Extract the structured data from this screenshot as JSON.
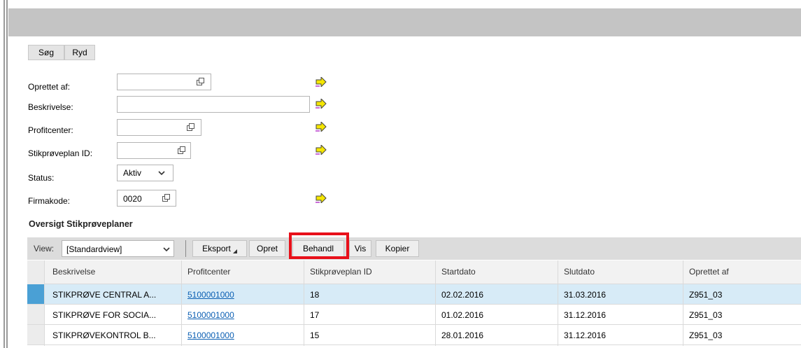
{
  "search": {
    "search_label": "Søg",
    "clear_label": "Ryd"
  },
  "form": {
    "created_by_label": "Oprettet af:",
    "created_by_value": "",
    "description_label": "Beskrivelse:",
    "description_value": "",
    "profit_center_label": "Profitcenter:",
    "profit_center_value": "",
    "plan_id_label": "Stikprøveplan ID:",
    "plan_id_value": "",
    "status_label": "Status:",
    "status_value": "Aktiv",
    "company_code_label": "Firmakode:",
    "company_code_value": "0020"
  },
  "section_title": "Oversigt Stikprøveplaner",
  "toolbar": {
    "view_label": "View:",
    "view_value": "[Standardview]",
    "export_label": "Eksport",
    "create_label": "Opret",
    "process_label": "Behandl",
    "show_label": "Vis",
    "copy_label": "Kopier"
  },
  "table": {
    "columns": [
      "Beskrivelse",
      "Profitcenter",
      "Stikprøveplan ID",
      "Startdato",
      "Slutdato",
      "Oprettet af"
    ],
    "rows": [
      {
        "description": "STIKPRØVE CENTRAL A...",
        "profit_center": "5100001000",
        "plan_id": "18",
        "start": "02.02.2016",
        "end": "31.03.2016",
        "created_by": "Z951_03"
      },
      {
        "description": "STIKPRØVE FOR SOCIA...",
        "profit_center": "5100001000",
        "plan_id": "17",
        "start": "01.02.2016",
        "end": "31.12.2016",
        "created_by": "Z951_03"
      },
      {
        "description": "STIKPRØVEKONTROL B...",
        "profit_center": "5100001000",
        "plan_id": "15",
        "start": "28.01.2016",
        "end": "31.12.2016",
        "created_by": "Z951_03"
      }
    ]
  },
  "colors": {
    "selected_row": "#d7ebf7",
    "link": "#0b5fb3",
    "highlight_box": "#e8101a",
    "arrow": "#f5e600"
  }
}
